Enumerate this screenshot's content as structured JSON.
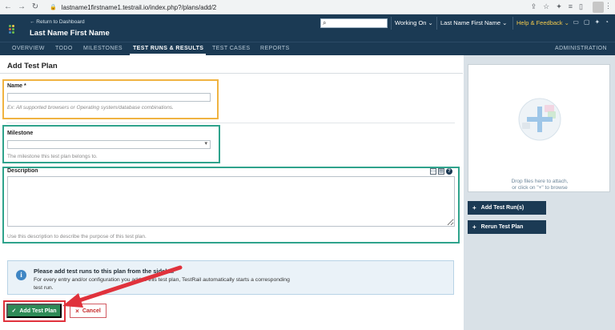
{
  "browser": {
    "url": "lastname1firstname1.testrail.io/index.php?/plans/add/2"
  },
  "header": {
    "back_link": "← Return to Dashboard",
    "project_name": "Last Name First Name",
    "working_on": "Working On",
    "user_name": "Last Name First Name",
    "help": "Help & Feedback"
  },
  "nav": {
    "overview": "OVERVIEW",
    "todo": "TODO",
    "milestones": "MILESTONES",
    "test_runs": "TEST RUNS & RESULTS",
    "test_cases": "TEST CASES",
    "reports": "REPORTS",
    "administration": "ADMINISTRATION"
  },
  "page": {
    "title": "Add Test Plan"
  },
  "form": {
    "name_label": "Name *",
    "name_value": "",
    "name_hint": "Ex: All supported browsers or Operating system/database combinations.",
    "milestone_label": "Milestone",
    "milestone_value": "",
    "milestone_hint": "The milestone this test plan belongs to.",
    "description_label": "Description",
    "description_value": "",
    "description_hint": "Use this description to describe the purpose of this test plan."
  },
  "info": {
    "title": "Please add test runs to this plan from the sidebar",
    "text": "For every entry and/or configuration you add to this test plan, TestRail automatically starts a corresponding test run."
  },
  "buttons": {
    "add_test_plan": "Add Test Plan",
    "cancel": "Cancel"
  },
  "sidebar": {
    "drop_text_1": "Drop files here to attach,",
    "drop_text_2": "or click on \"+\" to browse",
    "add_test_runs": "Add Test Run(s)",
    "rerun_test_plan": "Rerun Test Plan"
  },
  "colors": {
    "header_bg": "#1b3a54",
    "primary_green": "#2e8b57",
    "highlight_orange": "#f0b341",
    "highlight_teal": "#2fa38c",
    "highlight_red": "#e0323c"
  }
}
